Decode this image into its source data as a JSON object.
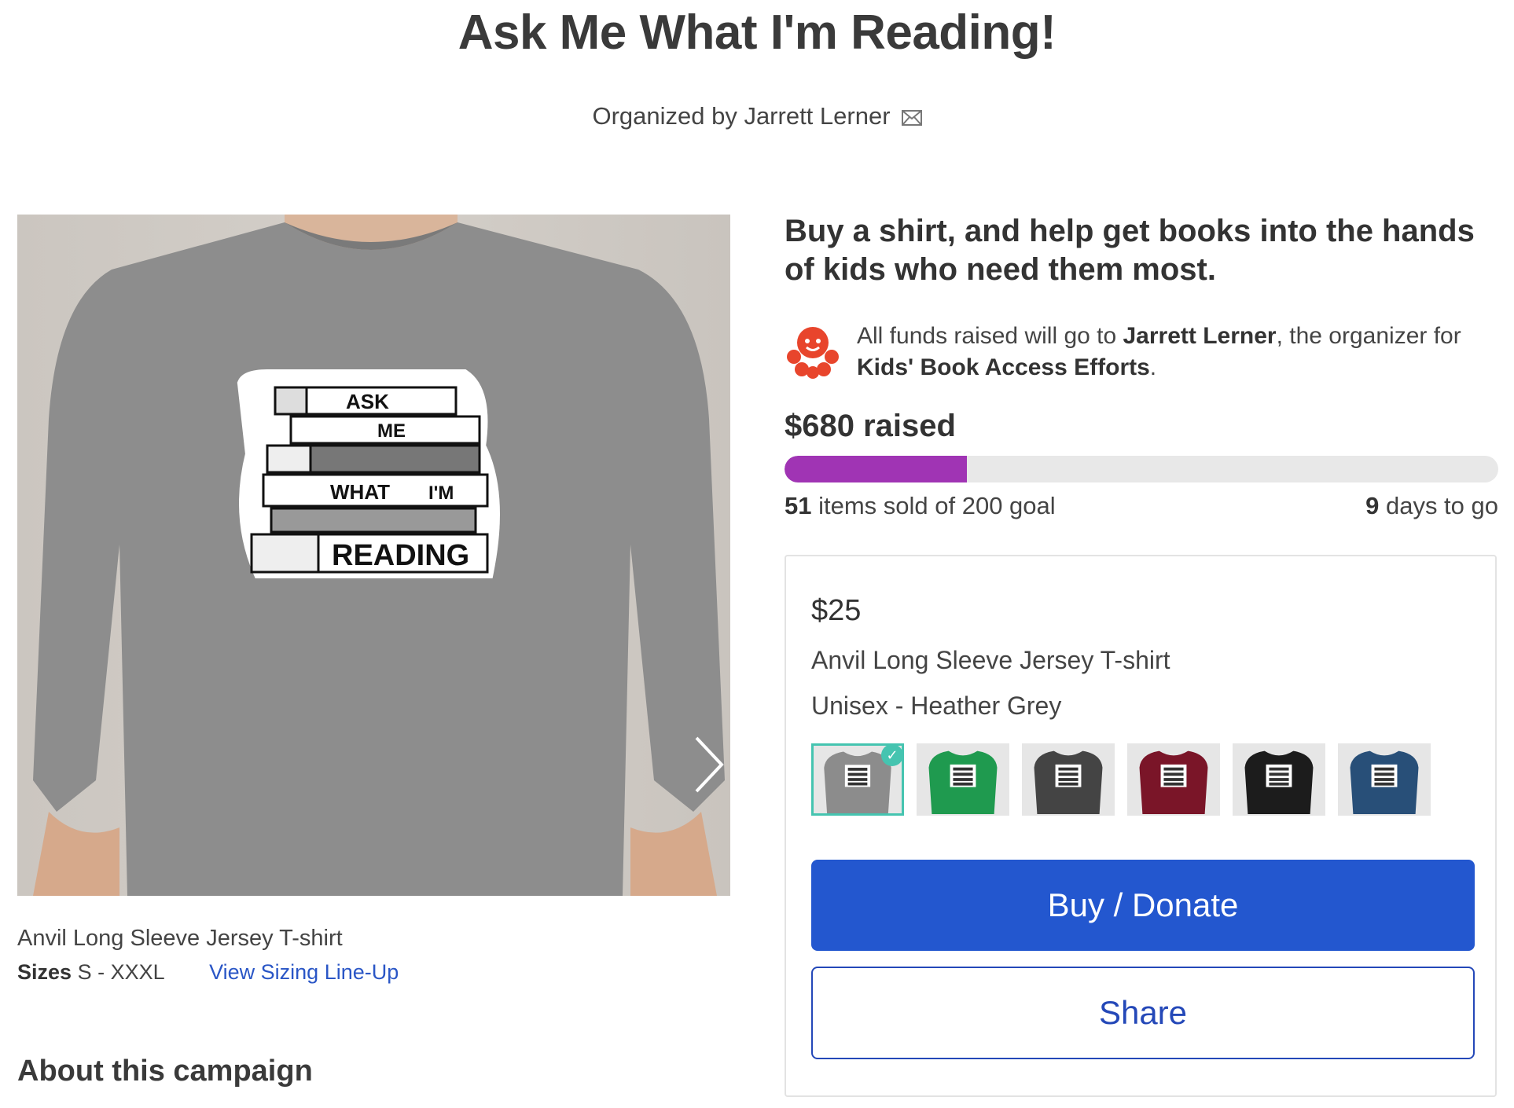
{
  "page": {
    "title": "Ask Me What I'm Reading!",
    "organizer_line": "Organized by Jarrett Lerner"
  },
  "design": {
    "text_lines": [
      "ASK",
      "ME",
      "WHAT",
      "I'M",
      "READING"
    ]
  },
  "product": {
    "name": "Anvil Long Sleeve Jersey T-shirt",
    "sizes_label": "Sizes",
    "sizes_value": "S - XXXL",
    "sizing_link": "View Sizing Line-Up"
  },
  "about": {
    "heading": "About this campaign"
  },
  "campaign": {
    "headline": "Buy a shirt, and help get books into the hands of kids who need them most.",
    "funds_prefix": "All funds raised will go to ",
    "funds_recipient": "Jarrett Lerner",
    "funds_middle": ", the organizer for ",
    "funds_cause": "Kids' Book Access Efforts",
    "funds_suffix": ".",
    "raised": "$680 raised",
    "progress_fraction": 0.255,
    "sold_count": "51",
    "sold_text": " items sold of 200 goal",
    "days_count": "9",
    "days_text": " days to go"
  },
  "card": {
    "price": "$25",
    "product_name": "Anvil Long Sleeve Jersey T-shirt",
    "variant": "Unisex - Heather Grey",
    "buy_label": "Buy / Donate",
    "share_label": "Share",
    "swatches": [
      {
        "color": "#8c8c8c",
        "bg": "#e6e6e6",
        "selected": true
      },
      {
        "color": "#1f9a4f",
        "bg": "#e6e6e6",
        "selected": false
      },
      {
        "color": "#444444",
        "bg": "#e6e6e6",
        "selected": false
      },
      {
        "color": "#7a1528",
        "bg": "#e6e6e6",
        "selected": false
      },
      {
        "color": "#1c1c1c",
        "bg": "#e6e6e6",
        "selected": false
      },
      {
        "color": "#284f78",
        "bg": "#e6e6e6",
        "selected": false
      }
    ]
  },
  "colors": {
    "accent_blue": "#2357cf",
    "progress_purple": "#a034b4",
    "logo_red": "#e8452c",
    "swatch_check": "#45c4b0"
  },
  "icons": {
    "mail": "mail-icon",
    "next": "chevron-right-icon",
    "rotate": "rotate-view-icon",
    "zoom": "zoom-in-icon",
    "logo": "gofundme-octopus-icon"
  }
}
